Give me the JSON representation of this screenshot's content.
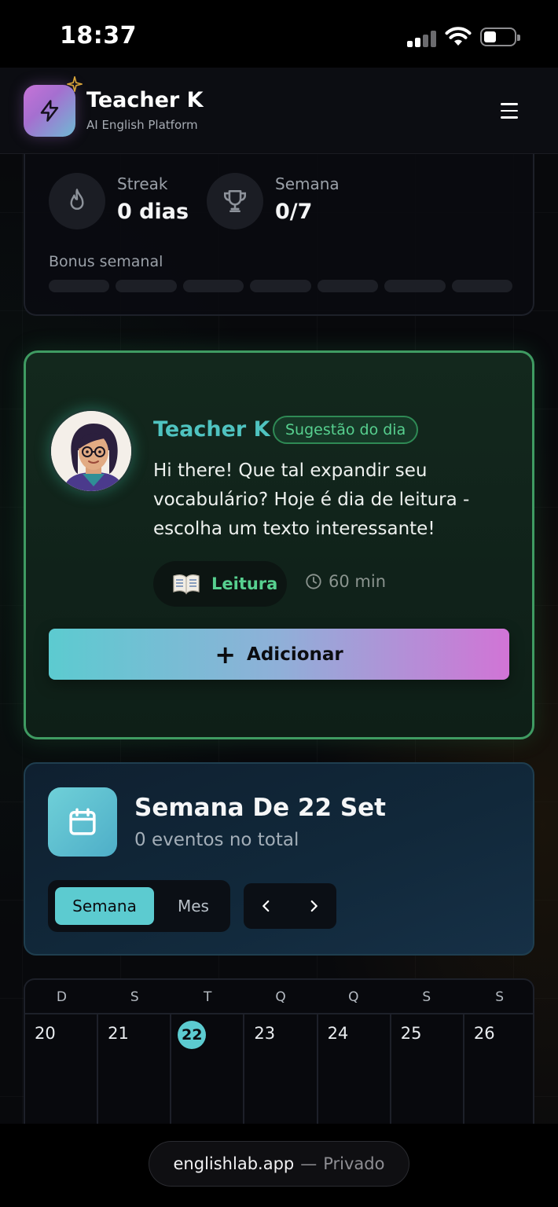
{
  "status_bar": {
    "time": "18:37"
  },
  "header": {
    "title": "Teacher K",
    "subtitle": "AI English Platform"
  },
  "stats": {
    "streak_label": "Streak",
    "streak_value": "0 dias",
    "week_label": "Semana",
    "week_value": "0/7",
    "bonus_label": "Bonus semanal",
    "bonus_progress": 0,
    "bonus_segments": 7
  },
  "suggestion": {
    "teacher_name": "Teacher K",
    "badge": "Sugestão do dia",
    "message": "Hi there! Que tal expandir seu vocabulário? Hoje é dia de leitura - escolha um texto interessante!",
    "activity_icon": "book-icon",
    "activity": "Leitura",
    "duration": "60 min",
    "add_label": "Adicionar"
  },
  "week": {
    "title": "Semana De 22 Set",
    "subtitle": "0 eventos no total",
    "toggle_week": "Semana",
    "toggle_month": "Mes",
    "active_view": "Semana"
  },
  "calendar": {
    "weekday_headers": [
      "D",
      "S",
      "T",
      "Q",
      "Q",
      "S",
      "S"
    ],
    "days": [
      "20",
      "21",
      "22",
      "23",
      "24",
      "25",
      "26"
    ],
    "today": "22"
  },
  "browser": {
    "domain": "englishlab.app",
    "separator": "—",
    "mode": "Privado"
  },
  "colors": {
    "accent_teal": "#5ccbd0",
    "accent_green": "#57d08f",
    "accent_pink": "#d174d6",
    "card_border_green": "#3f9b62"
  }
}
